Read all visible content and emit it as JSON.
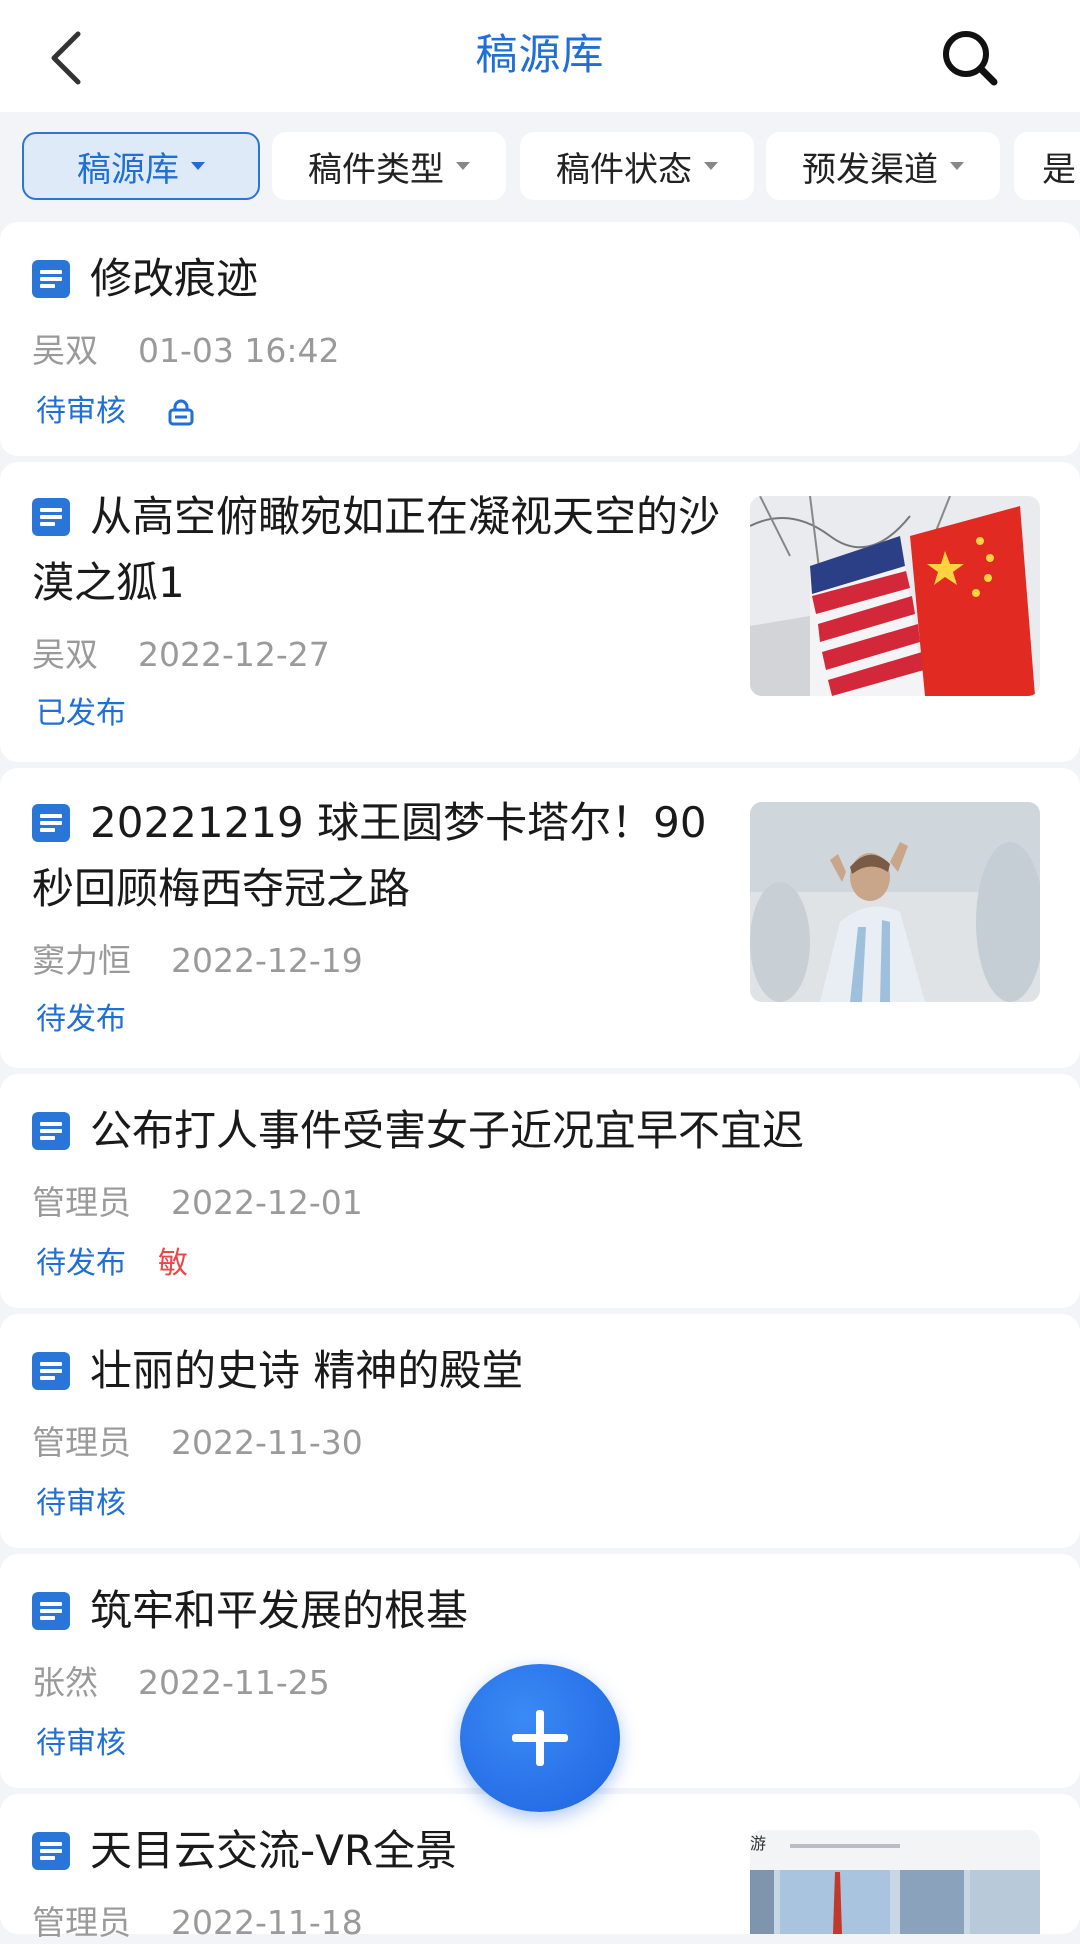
{
  "header": {
    "title": "稿源库",
    "back_icon": "chevron-left-icon",
    "search_icon": "search-icon"
  },
  "filters": [
    {
      "label": "稿源库",
      "active": true
    },
    {
      "label": "稿件类型",
      "active": false
    },
    {
      "label": "稿件状态",
      "active": false
    },
    {
      "label": "预发渠道",
      "active": false
    },
    {
      "label": "是",
      "active": false
    }
  ],
  "articles": [
    {
      "title": "修改痕迹",
      "author": "吴双",
      "date": "01-03 16:42",
      "status": "待审核",
      "locked": true
    },
    {
      "title": "从高空俯瞰宛如正在凝视天空的沙漠之狐1",
      "author": "吴双",
      "date": "2022-12-27",
      "status": "已发布",
      "thumbnail": "flags-image"
    },
    {
      "title": "20221219 球王圆梦卡塔尔！90秒回顾梅西夺冠之路",
      "author": "窦力恒",
      "date": "2022-12-19",
      "status": "待发布",
      "thumbnail": "player-image"
    },
    {
      "title": "公布打人事件受害女子近况宜早不宜迟",
      "author": "管理员",
      "date": "2022-12-01",
      "status": "待发布",
      "sensitive_tag": "敏"
    },
    {
      "title": "壮丽的史诗 精神的殿堂",
      "author": "管理员",
      "date": "2022-11-30",
      "status": "待审核"
    },
    {
      "title": "筑牢和平发展的根基",
      "author": "张然",
      "date": "2022-11-25",
      "status": "待审核"
    },
    {
      "title": "天目云交流-VR全景",
      "author": "管理员",
      "date": "2022-11-18",
      "thumbnail": "vr-image",
      "thumbnail_heading": "游"
    }
  ],
  "fab_icon": "plus-icon",
  "colors": {
    "accent": "#1f6fd6",
    "sensitive": "#e84848",
    "meta": "#9a9a9a"
  }
}
